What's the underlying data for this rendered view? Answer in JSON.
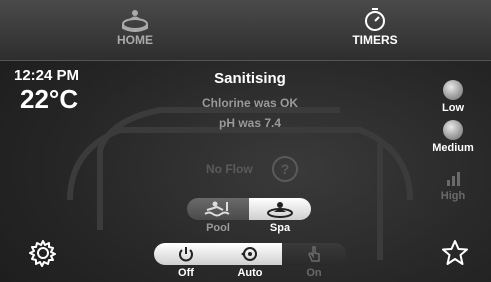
{
  "nav": {
    "home_label": "HOME",
    "timers_label": "TIMERS",
    "home_icon": "spa-tub-icon",
    "timers_icon": "stopwatch-icon"
  },
  "clock": {
    "time": "12:24 PM",
    "temperature": "22°C"
  },
  "status": {
    "title": "Sanitising",
    "line1": "Chlorine was OK",
    "line2": "pH was 7.4",
    "flow": "No Flow",
    "help": "?"
  },
  "pump_speed": {
    "low": "Low",
    "medium": "Medium",
    "high": "High"
  },
  "target": {
    "pool": "Pool",
    "spa": "Spa",
    "selected": "Spa"
  },
  "mode": {
    "off": "Off",
    "auto": "Auto",
    "on": "On"
  },
  "colors": {
    "active": "#ffffff",
    "inactive": "#6a6a6a",
    "background": "#262626"
  }
}
